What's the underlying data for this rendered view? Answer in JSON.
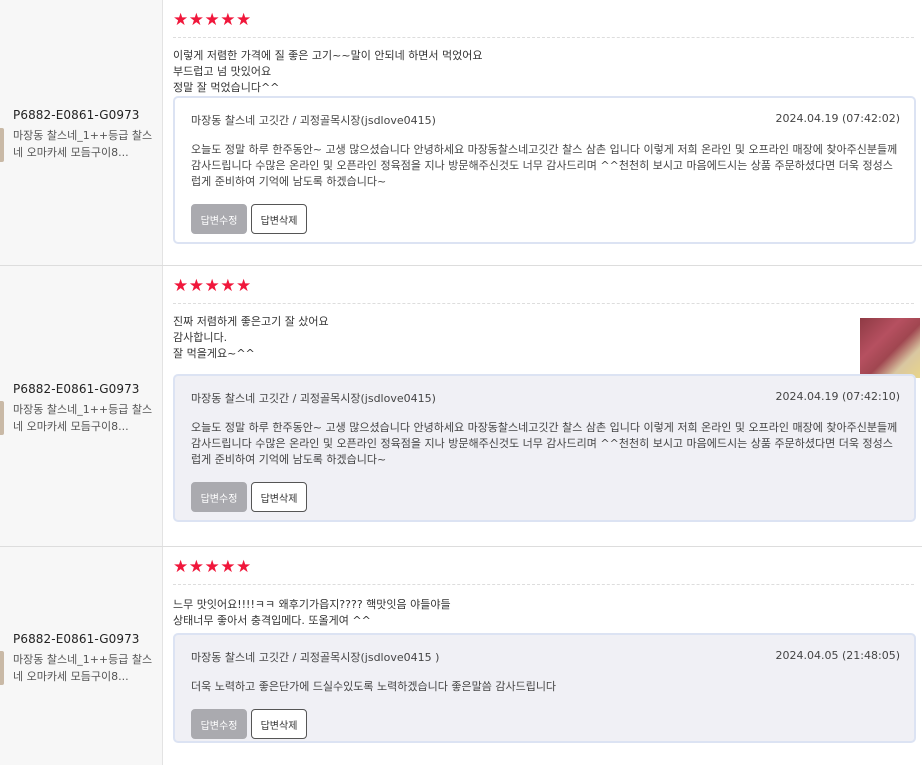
{
  "reviews": [
    {
      "product_code": "P6882-E0861-G0973",
      "product_name": "마장동 찰스네_1++등급 찰스네 오마카세 모듬구이8...",
      "stars": "★★★★★",
      "text": "이렇게 저렴한 가격에 질 좋은 고기~~말이 안되네 하면서 먹었어요\n부드럽고 넘 맛있어요\n정말 잘 먹었습니다^^",
      "has_photo": false,
      "reply": {
        "author": "마장동 찰스네 고깃간 / 괴정골목시장(jsdlove0415)",
        "date": "2024.04.19 (07:42:02)",
        "body": "오늘도 정말 하루 한주동안~ 고생 많으셨습니다 안녕하세요 마장동찰스네고깃간 찰스 삼촌 입니다 이렇게 저희 온라인 및 오프라인 매장에 찾아주신분들께 감사드립니다 수많은 온라인 및 오픈라인 정육점을 지나 방문해주신것도 너무 감사드리며 ^^천천히 보시고 마음에드시는 상품 주문하셨다면 더욱 정성스럽게 준비하여 기억에 남도록 하겠습니다~",
        "edit_label": "답변수정",
        "delete_label": "답변삭제"
      }
    },
    {
      "product_code": "P6882-E0861-G0973",
      "product_name": "마장동 찰스네_1++등급 찰스네 오마카세 모듬구이8...",
      "stars": "★★★★★",
      "text": "진짜 저렴하게 좋은고기 잘 샀어요\n감사합니다.\n잘 먹을게요~^^",
      "has_photo": true,
      "reply": {
        "author": "마장동 찰스네 고깃간 / 괴정골목시장(jsdlove0415)",
        "date": "2024.04.19 (07:42:10)",
        "body": "오늘도 정말 하루 한주동안~ 고생 많으셨습니다 안녕하세요 마장동찰스네고깃간 찰스 삼촌 입니다 이렇게 저희 온라인 및 오프라인 매장에 찾아주신분들께 감사드립니다 수많은 온라인 및 오픈라인 정육점을 지나 방문해주신것도 너무 감사드리며 ^^천천히 보시고 마음에드시는 상품 주문하셨다면 더욱 정성스럽게 준비하여 기억에 남도록 하겠습니다~",
        "edit_label": "답변수정",
        "delete_label": "답변삭제"
      }
    },
    {
      "product_code": "P6882-E0861-G0973",
      "product_name": "마장동 찰스네_1++등급 찰스네 오마카세 모듬구이8...",
      "stars": "★★★★★",
      "text": "느무 맛잇어요!!!!ㅋㅋ 왜후기가읍지???? 핵맛잇음 야들야들\n상태너무 좋아서 충격입메다. 또올게여 ^^",
      "has_photo": false,
      "reply": {
        "author": "마장동 찰스네 고깃간 / 괴정골목시장(jsdlove0415 )",
        "date": "2024.04.05 (21:48:05)",
        "body": "더욱 노력하고 좋은단가에 드실수있도록 노력하겠습니다 좋은말씀 감사드립니다",
        "edit_label": "답변수정",
        "delete_label": "답변삭제"
      }
    }
  ]
}
